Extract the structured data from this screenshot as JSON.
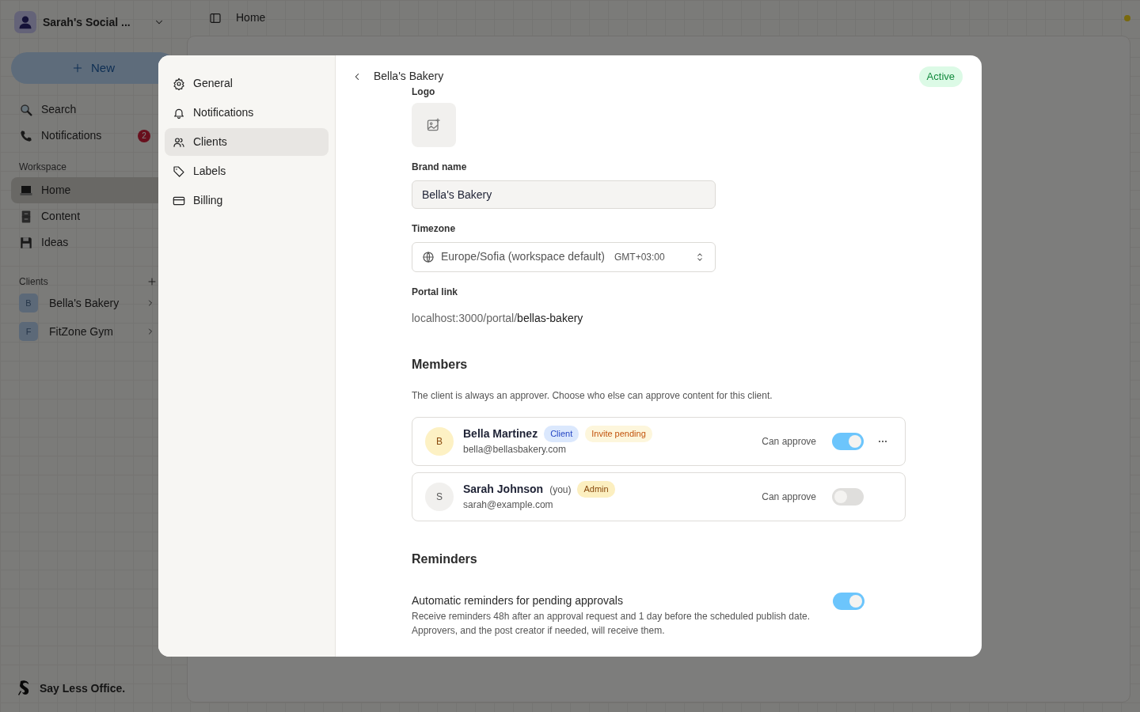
{
  "sidebar": {
    "workspace_name": "Sarah's Social ...",
    "new_button": "New",
    "items": [
      {
        "kind": "search",
        "label": "Search"
      },
      {
        "kind": "phone",
        "label": "Notifications",
        "badge": "2"
      }
    ],
    "workspace": {
      "title": "Workspace",
      "items": [
        {
          "kind": "laptop",
          "label": "Home",
          "selected": true
        },
        {
          "kind": "cabinet",
          "label": "Content",
          "selected": false
        },
        {
          "kind": "floppy",
          "label": "Ideas",
          "selected": false
        }
      ]
    },
    "clients": {
      "title": "Clients",
      "items": [
        {
          "initial": "B",
          "label": "Bella's Bakery"
        },
        {
          "initial": "F",
          "label": "FitZone Gym"
        }
      ]
    },
    "footer": "Say Less Office."
  },
  "header": {
    "title": "Home"
  },
  "modal": {
    "nav": [
      {
        "kind": "gear",
        "label": "General",
        "selected": false
      },
      {
        "kind": "bell",
        "label": "Notifications",
        "selected": false
      },
      {
        "kind": "users",
        "label": "Clients",
        "selected": true
      },
      {
        "kind": "tag",
        "label": "Labels",
        "selected": false
      },
      {
        "kind": "card",
        "label": "Billing",
        "selected": false
      }
    ],
    "title": "Bella's Bakery",
    "status": "Active",
    "logo_label": "Logo",
    "brand_name": {
      "label": "Brand name",
      "value": "Bella's Bakery"
    },
    "timezone": {
      "label": "Timezone",
      "value": "Europe/Sofia (workspace default)",
      "offset": "GMT+03:00"
    },
    "portal_link": {
      "label": "Portal link",
      "prefix": "localhost:3000/portal/",
      "slug": "bellas-bakery"
    },
    "members": {
      "title": "Members",
      "description": "The client is always an approver. Choose who else can approve content for this client.",
      "items": [
        {
          "initial": "B",
          "color": "#fdf1c4",
          "name": "Bella Martinez",
          "tags": [
            {
              "kind": "client",
              "label": "Client"
            },
            {
              "kind": "pending",
              "label": "Invite pending"
            }
          ],
          "email": "bella@bellasbakery.com",
          "approve_label": "Can approve",
          "can_approve": true,
          "menu": true
        },
        {
          "initial": "S",
          "color": "#f1f0ee",
          "name": "Sarah Johnson",
          "suffix": "(you)",
          "tags": [
            {
              "kind": "admin",
              "label": "Admin"
            }
          ],
          "email": "sarah@example.com",
          "approve_label": "Can approve",
          "can_approve": false,
          "menu": false
        }
      ]
    },
    "reminders": {
      "title": "Reminders",
      "items": [
        {
          "title": "Automatic reminders for pending approvals",
          "description": "Receive reminders 48h after an approval request and 1 day before the scheduled publish date. Approvers, and the post creator if needed, will receive them.",
          "on": true
        }
      ]
    }
  }
}
